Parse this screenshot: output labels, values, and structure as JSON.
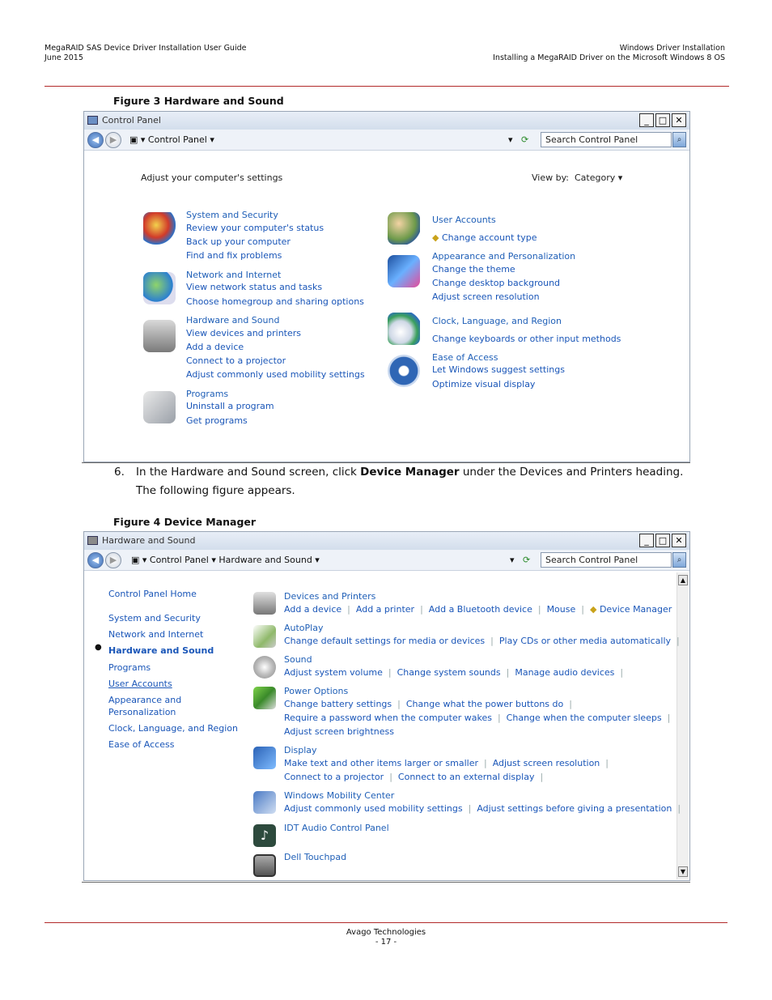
{
  "header": {
    "left_title": "MegaRAID SAS Device Driver Installation User Guide",
    "left_date": "June 2015",
    "right_title": "Windows Driver Installation",
    "right_subtitle": "Installing a MegaRAID Driver on the Microsoft Windows 8 OS"
  },
  "figure3": {
    "caption": "Figure 3  Hardware and Sound",
    "window_title": "Control Panel",
    "breadcrumb": "Control Panel",
    "search_placeholder": "Search Control Panel",
    "heading": "Adjust your computer's settings",
    "view_by_label": "View by:",
    "view_by_value": "Category",
    "left_groups": [
      {
        "title": "System and Security",
        "links": [
          "Review your computer's status",
          "Back up your computer",
          "Find and fix problems"
        ]
      },
      {
        "title": "Network and Internet",
        "links": [
          "View network status and tasks",
          "Choose homegroup and sharing options"
        ]
      },
      {
        "title": "Hardware and Sound",
        "links": [
          "View devices and printers",
          "Add a device",
          "Connect to a projector",
          "Adjust commonly used mobility settings"
        ]
      },
      {
        "title": "Programs",
        "links": [
          "Uninstall a program",
          "Get programs"
        ]
      }
    ],
    "right_groups": [
      {
        "title": "User Accounts",
        "links": [
          "Change account type"
        ]
      },
      {
        "title": "Appearance and Personalization",
        "links": [
          "Change the theme",
          "Change desktop background",
          "Adjust screen resolution"
        ]
      },
      {
        "title": "Clock, Language, and Region",
        "links": [
          "Change keyboards or other input methods"
        ]
      },
      {
        "title": "Ease of Access",
        "links": [
          "Let Windows suggest settings",
          "Optimize visual display"
        ]
      }
    ]
  },
  "step": {
    "number": "6.",
    "text_before": "In the Hardware and Sound screen, click ",
    "bold": "Device Manager",
    "text_after": " under the Devices and Printers heading.",
    "line2": "The following figure appears."
  },
  "figure4": {
    "caption": "Figure 4  Device Manager",
    "window_title": "Hardware and Sound",
    "breadcrumb1": "Control Panel",
    "breadcrumb2": "Hardware and Sound",
    "search_placeholder": "Search Control Panel",
    "nav": [
      "Control Panel Home",
      "System and Security",
      "Network and Internet",
      "Hardware and Sound",
      "Programs",
      "User Accounts",
      "Appearance and",
      "Personalization",
      "Clock, Language, and Region",
      "Ease of Access"
    ],
    "sections": [
      {
        "title": "Devices and Printers",
        "rows": [
          [
            "Add a device",
            "Add a printer",
            "Add a Bluetooth device",
            "Mouse",
            "Device Manager"
          ]
        ]
      },
      {
        "title": "AutoPlay",
        "rows": [
          [
            "Change default settings for media or devices",
            "Play CDs or other media automatically"
          ]
        ]
      },
      {
        "title": "Sound",
        "rows": [
          [
            "Adjust system volume",
            "Change system sounds",
            "Manage audio devices"
          ]
        ]
      },
      {
        "title": "Power Options",
        "rows": [
          [
            "Change battery settings",
            "Change what the power buttons do"
          ],
          [
            "Require a password when the computer wakes",
            "Change when the computer sleeps"
          ],
          [
            "Adjust screen brightness"
          ]
        ]
      },
      {
        "title": "Display",
        "rows": [
          [
            "Make text and other items larger or smaller",
            "Adjust screen resolution"
          ],
          [
            "Connect to a projector",
            "Connect to an external display"
          ]
        ]
      },
      {
        "title": "Windows Mobility Center",
        "rows": [
          [
            "Adjust commonly used mobility settings",
            "Adjust settings before giving a presentation"
          ]
        ]
      },
      {
        "title": "IDT Audio Control Panel",
        "rows": []
      },
      {
        "title": "Dell Touchpad",
        "rows": []
      }
    ]
  },
  "footer": {
    "company": "Avago Technologies",
    "page": "- 17 -"
  }
}
